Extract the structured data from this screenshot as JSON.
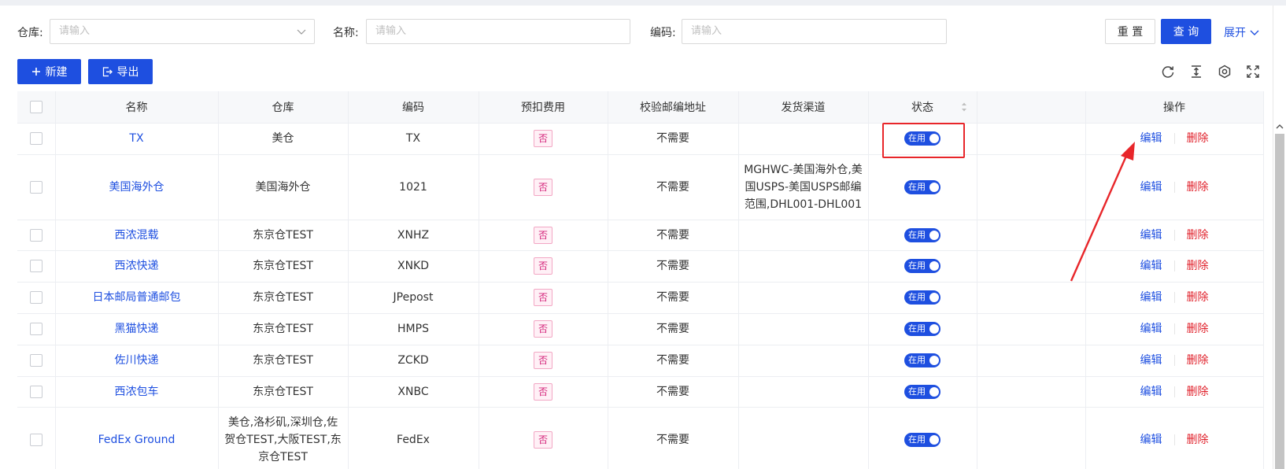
{
  "filters": {
    "warehouse_label": "仓库:",
    "warehouse_placeholder": "请输入",
    "name_label": "名称:",
    "name_placeholder": "请输入",
    "code_label": "编码:",
    "code_placeholder": "请输入",
    "reset_label": "重 置",
    "query_label": "查 询",
    "expand_label": "展开"
  },
  "toolbar": {
    "new_label": "新建",
    "export_label": "导出",
    "icons": [
      "refresh-icon",
      "column-height-icon",
      "settings-icon",
      "fullscreen-icon"
    ]
  },
  "table": {
    "headers": {
      "name": "名称",
      "warehouse": "仓库",
      "code": "编码",
      "prepaid": "预扣费用",
      "zip_check": "校验邮编地址",
      "channel": "发货渠道",
      "status": "状态",
      "blank": "",
      "ops": "操作"
    },
    "status_label": "在用",
    "edit_label": "编辑",
    "delete_label": "删除",
    "rows": [
      {
        "name": "TX",
        "warehouse": "美仓",
        "code": "TX",
        "prepaid": "否",
        "zip_check": "不需要",
        "channel": ""
      },
      {
        "name": "美国海外仓",
        "warehouse": "美国海外仓",
        "code": "1021",
        "prepaid": "否",
        "zip_check": "不需要",
        "channel": "MGHWC-美国海外仓,美国USPS-美国USPS邮编范围,DHL001-DHL001"
      },
      {
        "name": "西浓混载",
        "warehouse": "东京仓TEST",
        "code": "XNHZ",
        "prepaid": "否",
        "zip_check": "不需要",
        "channel": ""
      },
      {
        "name": "西浓快递",
        "warehouse": "东京仓TEST",
        "code": "XNKD",
        "prepaid": "否",
        "zip_check": "不需要",
        "channel": ""
      },
      {
        "name": "日本邮局普通邮包",
        "warehouse": "东京仓TEST",
        "code": "JPepost",
        "prepaid": "否",
        "zip_check": "不需要",
        "channel": ""
      },
      {
        "name": "黑猫快递",
        "warehouse": "东京仓TEST",
        "code": "HMPS",
        "prepaid": "否",
        "zip_check": "不需要",
        "channel": ""
      },
      {
        "name": "佐川快递",
        "warehouse": "东京仓TEST",
        "code": "ZCKD",
        "prepaid": "否",
        "zip_check": "不需要",
        "channel": ""
      },
      {
        "name": "西浓包车",
        "warehouse": "东京仓TEST",
        "code": "XNBC",
        "prepaid": "否",
        "zip_check": "不需要",
        "channel": ""
      },
      {
        "name": "FedEx Ground",
        "warehouse": "美仓,洛杉矶,深圳仓,佐贺仓TEST,大阪TEST,东京仓TEST",
        "code": "FedEx",
        "prepaid": "否",
        "zip_check": "不需要",
        "channel": ""
      }
    ]
  },
  "colors": {
    "primary": "#1e4fe0",
    "danger": "#e0212b",
    "annotation": "#e8262a"
  }
}
